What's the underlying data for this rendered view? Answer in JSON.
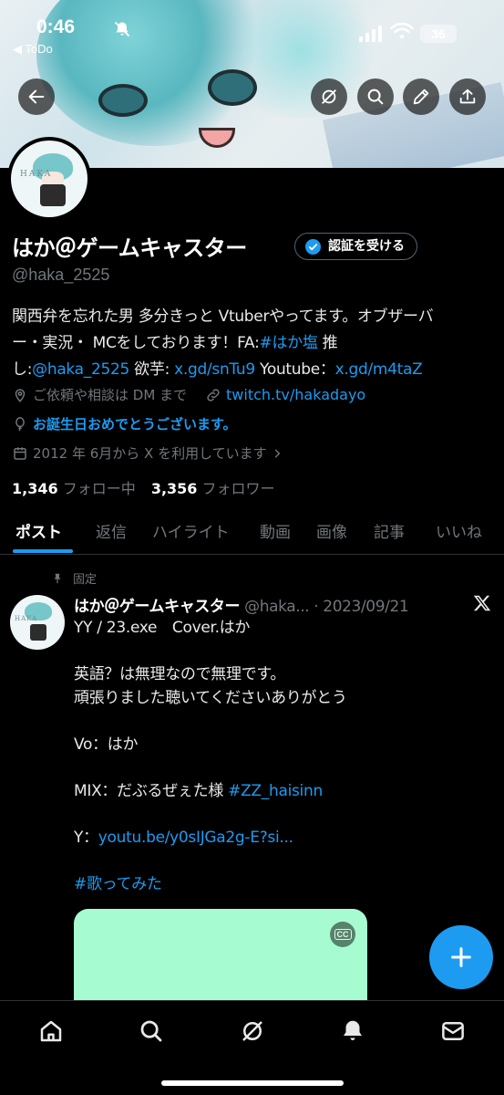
{
  "status_bar": {
    "time": "0:46",
    "back_app": "◀ ToDo",
    "battery": "36"
  },
  "profile": {
    "display_name": "はか＠ゲームキャスター",
    "verify_button": "認証を受ける",
    "handle": "@haka_2525",
    "avatar_label": "HAKA",
    "bio": {
      "line1_text": "関西弁を忘れた男 多分きっと Vtuberやってます。オブザーバ",
      "line2_text": "ー・実況・ MCをしております！FA:",
      "line2_hashtag": "#はか塩",
      "line2_tail": " 推",
      "line3_prefix": "し:",
      "line3_mention": "@haka_2525",
      "line3_mid": " 欲芋: ",
      "line3_link1": "x.gd/snTu9",
      "line3_mid2": " Youtube：",
      "line3_link2": "x.gd/m4taZ"
    },
    "location": "ご依頼や相談は DM まで",
    "website": "twitch.tv/hakadayo",
    "birthday": "お誕生日おめでとうございます。",
    "joined": "2012 年 6月から X を利用しています",
    "following_count": "1,346",
    "following_label": "フォロー中",
    "followers_count": "3,356",
    "followers_label": "フォロワー"
  },
  "tabs": [
    {
      "label": "ポスト",
      "active": true
    },
    {
      "label": "返信",
      "active": false
    },
    {
      "label": "ハイライト",
      "active": false
    },
    {
      "label": "動画",
      "active": false
    },
    {
      "label": "画像",
      "active": false
    },
    {
      "label": "記事",
      "active": false
    },
    {
      "label": "いいね",
      "active": false
    }
  ],
  "pinned_tweet": {
    "pinned_label": "固定",
    "author_name": "はか＠ゲームキャスター",
    "author_handle": "@haka...",
    "date": " · 2023/09/21",
    "avatar_label": "HAKA",
    "lines": {
      "l1": "YY / 23.exe　Cover.はか",
      "l2": "英語？は無理なので無理です。",
      "l3": "頑張りました聴いてくださいありがとう",
      "l4": "Vo：はか",
      "l5_prefix": "MIX：だぶるぜぇた様 ",
      "l5_hashtag": "#ZZ_haisinn",
      "l6_prefix": "Y：",
      "l6_link": "youtu.be/y0sIJGa2g-E?si...",
      "l7_hashtag": "#歌ってみた"
    },
    "media_color": "#a7fbd0",
    "cc_label": "CC"
  },
  "icons": {
    "back": "arrow-left-icon",
    "grok": "grok-icon",
    "search": "search-icon",
    "edit": "pencil-icon",
    "share": "share-icon",
    "fab": "plus-icon",
    "nav": [
      "home-icon",
      "search-icon",
      "grok-icon",
      "bell-icon",
      "mail-icon"
    ]
  },
  "colors": {
    "accent": "#1d9bf0",
    "background": "#000000",
    "text": "#e7e9ea",
    "secondary": "#71767b"
  }
}
